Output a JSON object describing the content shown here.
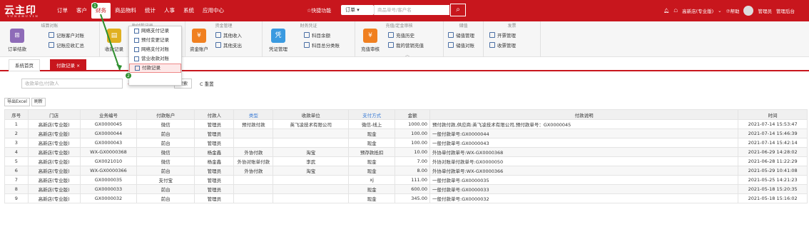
{
  "logo": {
    "text": "云主印",
    "sub": "YUNZHUYIN"
  },
  "nav": [
    "订单",
    "客户",
    "财务",
    "商品物料",
    "统计",
    "人事",
    "系统",
    "应用中心"
  ],
  "nav_active": 2,
  "quick_label": "☆快捷功能",
  "search": {
    "type": "订单",
    "placeholder": "商品单号/客户名"
  },
  "topright": {
    "store": "高新店(专业版)",
    "help": "⑦帮助",
    "user": "管理员",
    "backend": "管理后台"
  },
  "ribbon": {
    "g1": {
      "title": "结算对账",
      "big": "订单结款",
      "s1": "记账客户对账",
      "s2": "记账应收汇总"
    },
    "g2": {
      "title": "收付款记录",
      "big": "收款记录"
    },
    "g3": {
      "title": "资金管理",
      "big": "资金账户",
      "s1": "其他收入",
      "s2": "其他支出"
    },
    "g4": {
      "title": "财务凭证",
      "big": "凭证管理",
      "s1": "科目余额",
      "s2": "科目总分类账"
    },
    "g5": {
      "title": "充值/定金审核",
      "big": "充值审核",
      "s1": "充值历史",
      "s2": "我的营销充值"
    },
    "g6": {
      "title": "储值",
      "s1": "储值管理",
      "s2": "储值对账"
    },
    "g7": {
      "title": "发票",
      "s1": "开票管理",
      "s2": "收票管理"
    }
  },
  "dropdown": [
    "网络支付记录",
    "预付变更记录",
    "网络支付对账",
    "营业收款对账",
    "付款记录"
  ],
  "tabs": {
    "home": "系统首页",
    "current": "付款记录"
  },
  "filter": {
    "placeholder": "收款单位/付款人",
    "search": "搜索",
    "reset": "C 重置"
  },
  "toolbar": {
    "export": "导出Excel",
    "refresh": "刷新"
  },
  "columns": [
    "序号",
    "门店",
    "业务编号",
    "付款账户",
    "付款人",
    "类型",
    "收款单位",
    "支付方式",
    "金额",
    "付款说明",
    "时间"
  ],
  "rows": [
    [
      "1",
      "高新店(专业版)",
      "GX0000045",
      "微信",
      "管理员",
      "预付款付款",
      "英飞凌技术有限公司",
      "微信-线上",
      "1000.00",
      "预付款付款,供应商:英飞凌技术有限公司,预付款单号：GX0000045",
      "2021-07-14 15:53:47"
    ],
    [
      "2",
      "高新店(专业版)",
      "GX0000044",
      "前台",
      "管理员",
      "",
      "",
      "现金",
      "100.00",
      "一般付款单号:GX0000044",
      "2021-07-14 15:46:39"
    ],
    [
      "3",
      "高新店(专业版)",
      "GX0000043",
      "前台",
      "管理员",
      "",
      "",
      "现金",
      "100.00",
      "一般付款单号:GX0000043",
      "2021-07-14 15:42:14"
    ],
    [
      "4",
      "高新店(专业版)",
      "WX-GX0000368",
      "微信",
      "杨金鑫",
      "外协付款",
      "淘宝",
      "预存款抵扣",
      "10.00",
      "外协单付款单号:WX-GX0000368",
      "2021-06-29 14:28:02"
    ],
    [
      "5",
      "高新店(专业版)",
      "GX0021010",
      "微信",
      "杨金鑫",
      "外协对账单付款",
      "李武",
      "现金",
      "7.00",
      "外协对账单付款单号:GX0000050",
      "2021-06-28 11:22:29"
    ],
    [
      "6",
      "高新店(专业版)",
      "WX-GX0000366",
      "前台",
      "管理员",
      "外协付款",
      "淘宝",
      "现金",
      "8.00",
      "外协单付款单号:WX-GX0000366",
      "2021-05-29 10:41:08"
    ],
    [
      "7",
      "高新店(专业版)",
      "GX0000035",
      "支付宝",
      "管理员",
      "",
      "",
      "xj",
      "111.00",
      "一般付款单号:GX0000035",
      "2021-05-25 14:21:23"
    ],
    [
      "8",
      "高新店(专业版)",
      "GX0000033",
      "前台",
      "管理员",
      "",
      "",
      "现金",
      "600.00",
      "一般付款单号:GX0000033",
      "2021-05-18 15:20:35"
    ],
    [
      "9",
      "高新店(专业版)",
      "GX0000032",
      "前台",
      "管理员",
      "",
      "",
      "现金",
      "345.00",
      "一般付款单号:GX0000032",
      "2021-05-18 15:16:02"
    ]
  ],
  "badges": [
    "1",
    "2"
  ]
}
